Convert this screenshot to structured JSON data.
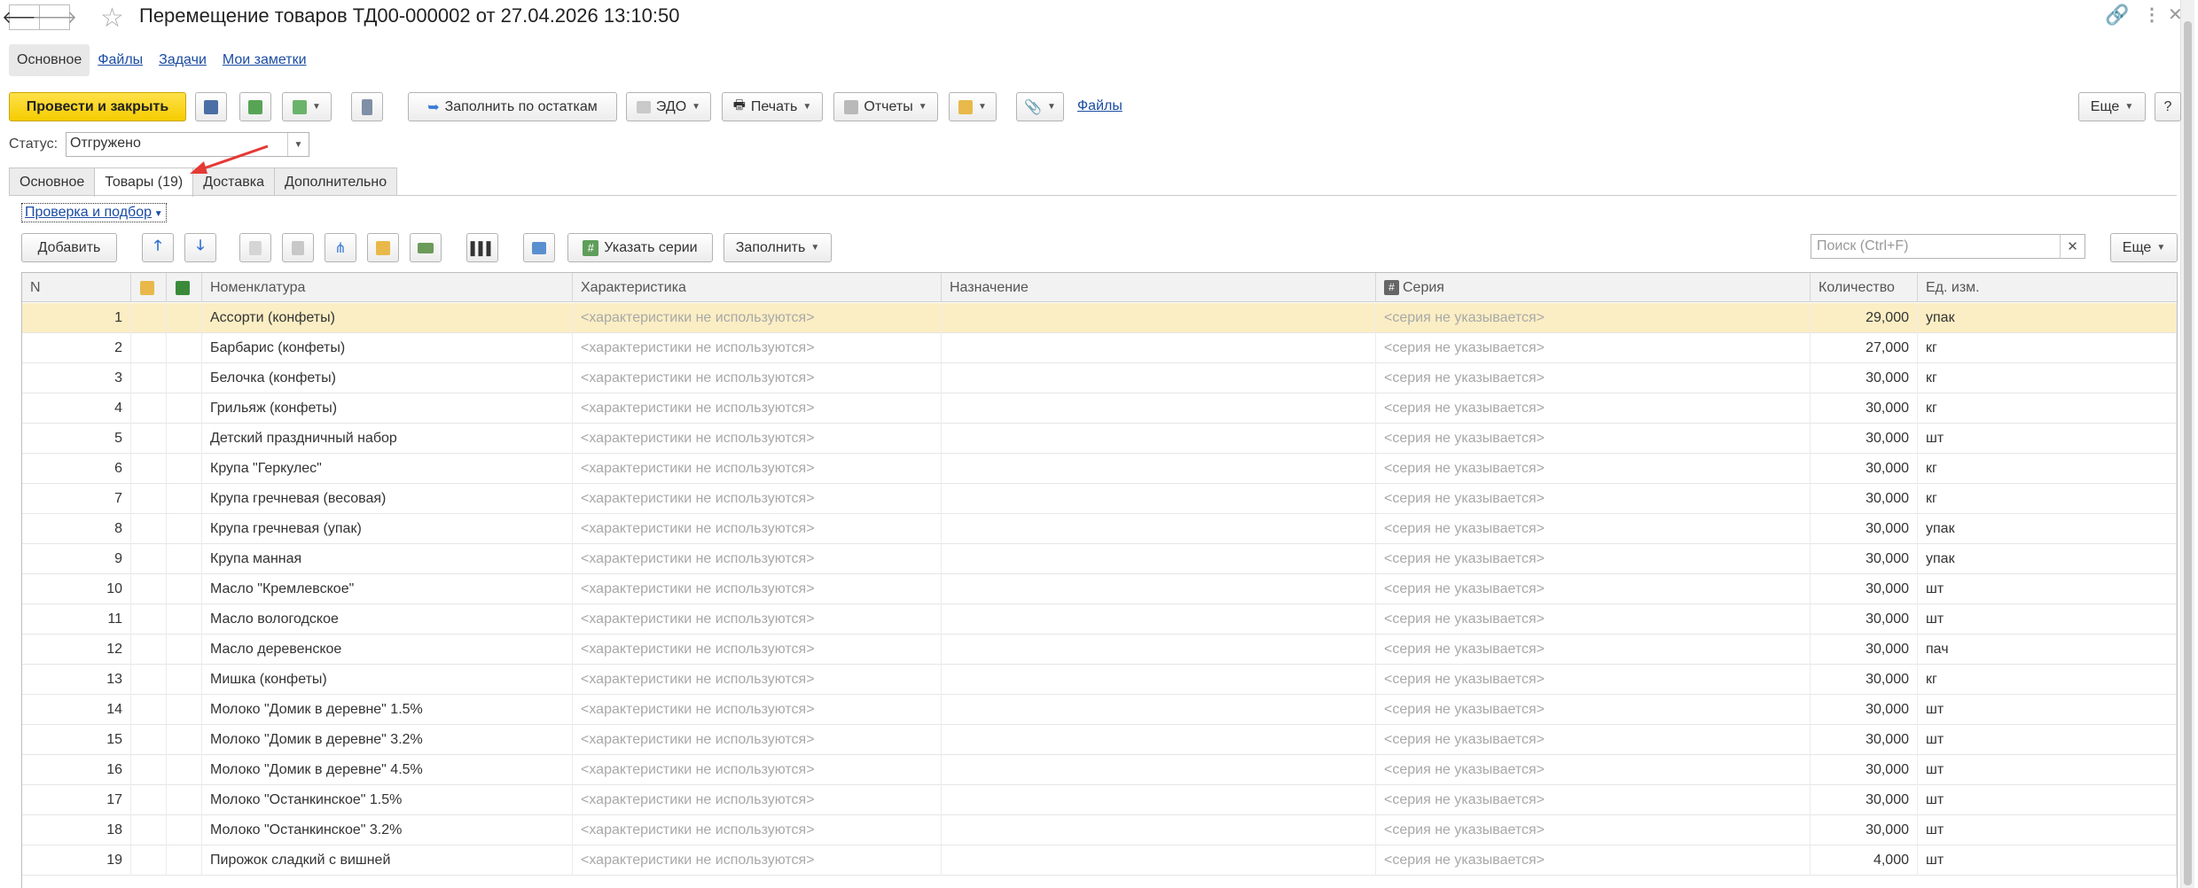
{
  "header": {
    "title": "Перемещение товаров ТД00-000002 от 27.04.2026 13:10:50"
  },
  "top_tabs": [
    {
      "label": "Основное",
      "active": true
    },
    {
      "label": "Файлы"
    },
    {
      "label": "Задачи"
    },
    {
      "label": "Мои заметки"
    }
  ],
  "toolbar": {
    "post_close": "Провести и закрыть",
    "fill_by_stock": "Заполнить по остаткам",
    "edo": "ЭДО",
    "print": "Печать",
    "reports": "Отчеты",
    "files_link": "Файлы",
    "more": "Еще",
    "help": "?"
  },
  "status": {
    "label": "Статус:",
    "value": "Отгружено"
  },
  "form_tabs": [
    {
      "label": "Основное"
    },
    {
      "label": "Товары (19)",
      "active": true
    },
    {
      "label": "Доставка"
    },
    {
      "label": "Дополнительно"
    }
  ],
  "goods": {
    "check_link": "Проверка и подбор",
    "add": "Добавить",
    "specify_series": "Указать серии",
    "fill": "Заполнить",
    "search_placeholder": "Поиск (Ctrl+F)",
    "more": "Еще"
  },
  "columns": [
    "N",
    "Номенклатура",
    "Характеристика",
    "Назначение",
    "Серия",
    "Количество",
    "Ед. изм."
  ],
  "rows": [
    {
      "n": "1",
      "name": "Ассорти (конфеты)",
      "char": "<характеристики не используются>",
      "purpose": "",
      "series": "<серия не указывается>",
      "qty": "29,000",
      "unit": "упак"
    },
    {
      "n": "2",
      "name": "Барбарис (конфеты)",
      "char": "<характеристики не используются>",
      "purpose": "",
      "series": "<серия не указывается>",
      "qty": "27,000",
      "unit": "кг"
    },
    {
      "n": "3",
      "name": "Белочка (конфеты)",
      "char": "<характеристики не используются>",
      "purpose": "",
      "series": "<серия не указывается>",
      "qty": "30,000",
      "unit": "кг"
    },
    {
      "n": "4",
      "name": "Грильяж (конфеты)",
      "char": "<характеристики не используются>",
      "purpose": "",
      "series": "<серия не указывается>",
      "qty": "30,000",
      "unit": "кг"
    },
    {
      "n": "5",
      "name": "Детский праздничный набор",
      "char": "<характеристики не используются>",
      "purpose": "",
      "series": "<серия не указывается>",
      "qty": "30,000",
      "unit": "шт"
    },
    {
      "n": "6",
      "name": "Крупа \"Геркулес\"",
      "char": "<характеристики не используются>",
      "purpose": "",
      "series": "<серия не указывается>",
      "qty": "30,000",
      "unit": "кг"
    },
    {
      "n": "7",
      "name": "Крупа гречневая (весовая)",
      "char": "<характеристики не используются>",
      "purpose": "",
      "series": "<серия не указывается>",
      "qty": "30,000",
      "unit": "кг"
    },
    {
      "n": "8",
      "name": "Крупа гречневая (упак)",
      "char": "<характеристики не используются>",
      "purpose": "",
      "series": "<серия не указывается>",
      "qty": "30,000",
      "unit": "упак"
    },
    {
      "n": "9",
      "name": "Крупа манная",
      "char": "<характеристики не используются>",
      "purpose": "",
      "series": "<серия не указывается>",
      "qty": "30,000",
      "unit": "упак"
    },
    {
      "n": "10",
      "name": "Масло \"Кремлевское\"",
      "char": "<характеристики не используются>",
      "purpose": "",
      "series": "<серия не указывается>",
      "qty": "30,000",
      "unit": "шт"
    },
    {
      "n": "11",
      "name": "Масло вологодское",
      "char": "<характеристики не используются>",
      "purpose": "",
      "series": "<серия не указывается>",
      "qty": "30,000",
      "unit": "шт"
    },
    {
      "n": "12",
      "name": "Масло деревенское",
      "char": "<характеристики не используются>",
      "purpose": "",
      "series": "<серия не указывается>",
      "qty": "30,000",
      "unit": "пач"
    },
    {
      "n": "13",
      "name": "Мишка (конфеты)",
      "char": "<характеристики не используются>",
      "purpose": "",
      "series": "<серия не указывается>",
      "qty": "30,000",
      "unit": "кг"
    },
    {
      "n": "14",
      "name": "Молоко \"Домик в деревне\" 1.5%",
      "char": "<характеристики не используются>",
      "purpose": "",
      "series": "<серия не указывается>",
      "qty": "30,000",
      "unit": "шт"
    },
    {
      "n": "15",
      "name": "Молоко \"Домик в деревне\" 3.2%",
      "char": "<характеристики не используются>",
      "purpose": "",
      "series": "<серия не указывается>",
      "qty": "30,000",
      "unit": "шт"
    },
    {
      "n": "16",
      "name": "Молоко \"Домик в деревне\" 4.5%",
      "char": "<характеристики не используются>",
      "purpose": "",
      "series": "<серия не указывается>",
      "qty": "30,000",
      "unit": "шт"
    },
    {
      "n": "17",
      "name": "Молоко \"Останкинское\" 1.5%",
      "char": "<характеристики не используются>",
      "purpose": "",
      "series": "<серия не указывается>",
      "qty": "30,000",
      "unit": "шт"
    },
    {
      "n": "18",
      "name": "Молоко \"Останкинское\" 3.2%",
      "char": "<характеристики не используются>",
      "purpose": "",
      "series": "<серия не указывается>",
      "qty": "30,000",
      "unit": "шт"
    },
    {
      "n": "19",
      "name": "Пирожок сладкий с вишней",
      "char": "<характеристики не используются>",
      "purpose": "",
      "series": "<серия не указывается>",
      "qty": "4,000",
      "unit": "шт"
    }
  ]
}
